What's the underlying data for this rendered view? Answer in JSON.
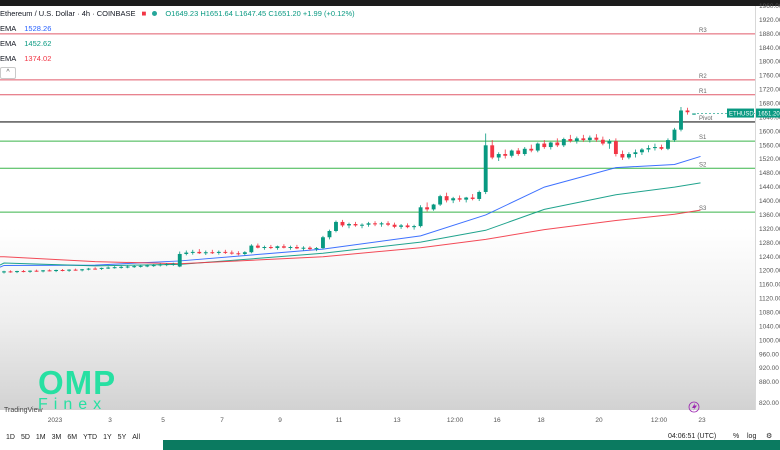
{
  "header": {
    "symbol": "Ethereum / U.S. Dollar · 4h · COINBASE",
    "ohlc": "O1649.23  H1651.64  L1647.45  C1651.20  +1.99 (+0.12%)",
    "close_icon": "close-icon",
    "status_icon": "dot-icon"
  },
  "indicators": [
    {
      "name": "EMA",
      "value": "1528.26",
      "color": "#2962ff"
    },
    {
      "name": "EMA",
      "value": "1452.62",
      "color": "#089981"
    },
    {
      "name": "EMA",
      "value": "1374.02",
      "color": "#f23645"
    }
  ],
  "toggle_label": "^",
  "tradingview_label": "TradingView",
  "price_tag": "1651.20",
  "ticker_tag": "ETHUSD",
  "time_ranges": [
    "1D",
    "5D",
    "1M",
    "3M",
    "6M",
    "YTD",
    "1Y",
    "5Y",
    "All"
  ],
  "clock": "04:06:51 (UTC)",
  "axis_controls": {
    "percent": "%",
    "log": "log",
    "settings_icon": "gear-icon"
  },
  "logo": {
    "line1": "OMP",
    "line2": "Finex"
  },
  "chart_data": {
    "type": "candlestick",
    "title": "Ethereum / U.S. Dollar · 4h · COINBASE",
    "ylim": [
      800,
      1960
    ],
    "yticks": [
      820,
      880,
      920,
      960,
      1000,
      1040,
      1080,
      1120,
      1160,
      1200,
      1240,
      1280,
      1320,
      1360,
      1400,
      1440,
      1480,
      1520,
      1560,
      1600,
      1640,
      1680,
      1720,
      1760,
      1800,
      1840,
      1880,
      1920,
      1960
    ],
    "xticks": [
      "2023",
      "3",
      "5",
      "7",
      "9",
      "11",
      "13",
      "12:00",
      "16",
      "18",
      "20",
      "12:00",
      "23"
    ],
    "levels": [
      {
        "name": "R3",
        "value": 1880,
        "color": "#e05a6a"
      },
      {
        "name": "R2",
        "value": 1748,
        "color": "#e05a6a"
      },
      {
        "name": "R1",
        "value": 1705,
        "color": "#e05a6a"
      },
      {
        "name": "Pivot",
        "value": 1627,
        "color": "#222222"
      },
      {
        "name": "S1",
        "value": 1572,
        "color": "#3ab54a"
      },
      {
        "name": "S2",
        "value": 1494,
        "color": "#3ab54a"
      },
      {
        "name": "S3",
        "value": 1368,
        "color": "#3ab54a"
      }
    ],
    "candles": [
      [
        1195,
        1200,
        1192,
        1198
      ],
      [
        1198,
        1201,
        1194,
        1196
      ],
      [
        1196,
        1200,
        1193,
        1199
      ],
      [
        1199,
        1202,
        1195,
        1197
      ],
      [
        1197,
        1201,
        1194,
        1200
      ],
      [
        1200,
        1203,
        1197,
        1198
      ],
      [
        1198,
        1202,
        1195,
        1201
      ],
      [
        1201,
        1204,
        1198,
        1199
      ],
      [
        1199,
        1203,
        1196,
        1202
      ],
      [
        1202,
        1205,
        1198,
        1200
      ],
      [
        1200,
        1204,
        1197,
        1203
      ],
      [
        1203,
        1206,
        1200,
        1201
      ],
      [
        1201,
        1205,
        1198,
        1204
      ],
      [
        1204,
        1208,
        1201,
        1206
      ],
      [
        1206,
        1210,
        1203,
        1205
      ],
      [
        1205,
        1209,
        1202,
        1208
      ],
      [
        1208,
        1212,
        1205,
        1209
      ],
      [
        1209,
        1213,
        1206,
        1210
      ],
      [
        1210,
        1214,
        1206,
        1211
      ],
      [
        1211,
        1215,
        1207,
        1212
      ],
      [
        1212,
        1216,
        1208,
        1213
      ],
      [
        1213,
        1217,
        1209,
        1214
      ],
      [
        1214,
        1218,
        1210,
        1215
      ],
      [
        1215,
        1219,
        1211,
        1216
      ],
      [
        1216,
        1221,
        1212,
        1218
      ],
      [
        1218,
        1222,
        1213,
        1219
      ],
      [
        1219,
        1223,
        1214,
        1220
      ],
      [
        1212,
        1255,
        1210,
        1248
      ],
      [
        1248,
        1258,
        1244,
        1252
      ],
      [
        1252,
        1260,
        1246,
        1254
      ],
      [
        1254,
        1262,
        1248,
        1250
      ],
      [
        1250,
        1258,
        1245,
        1253
      ],
      [
        1253,
        1260,
        1248,
        1251
      ],
      [
        1251,
        1258,
        1246,
        1254
      ],
      [
        1254,
        1260,
        1248,
        1252
      ],
      [
        1252,
        1258,
        1246,
        1250
      ],
      [
        1250,
        1256,
        1244,
        1248
      ],
      [
        1248,
        1256,
        1244,
        1253
      ],
      [
        1253,
        1276,
        1250,
        1272
      ],
      [
        1272,
        1278,
        1264,
        1266
      ],
      [
        1266,
        1272,
        1260,
        1268
      ],
      [
        1268,
        1274,
        1262,
        1265
      ],
      [
        1265,
        1272,
        1260,
        1270
      ],
      [
        1270,
        1276,
        1264,
        1266
      ],
      [
        1266,
        1272,
        1260,
        1268
      ],
      [
        1268,
        1274,
        1262,
        1264
      ],
      [
        1264,
        1270,
        1258,
        1266
      ],
      [
        1266,
        1270,
        1258,
        1262
      ],
      [
        1262,
        1268,
        1256,
        1265
      ],
      [
        1265,
        1300,
        1262,
        1296
      ],
      [
        1296,
        1318,
        1290,
        1314
      ],
      [
        1314,
        1344,
        1310,
        1340
      ],
      [
        1340,
        1346,
        1325,
        1330
      ],
      [
        1330,
        1338,
        1322,
        1334
      ],
      [
        1334,
        1340,
        1326,
        1330
      ],
      [
        1330,
        1336,
        1322,
        1332
      ],
      [
        1332,
        1340,
        1326,
        1336
      ],
      [
        1336,
        1342,
        1328,
        1333
      ],
      [
        1333,
        1340,
        1326,
        1336
      ],
      [
        1336,
        1342,
        1328,
        1332
      ],
      [
        1332,
        1338,
        1322,
        1326
      ],
      [
        1326,
        1334,
        1320,
        1330
      ],
      [
        1330,
        1336,
        1322,
        1325
      ],
      [
        1325,
        1332,
        1318,
        1328
      ],
      [
        1328,
        1388,
        1324,
        1382
      ],
      [
        1382,
        1396,
        1370,
        1376
      ],
      [
        1376,
        1392,
        1372,
        1390
      ],
      [
        1390,
        1418,
        1386,
        1414
      ],
      [
        1414,
        1424,
        1396,
        1402
      ],
      [
        1402,
        1412,
        1394,
        1408
      ],
      [
        1408,
        1416,
        1398,
        1404
      ],
      [
        1404,
        1412,
        1396,
        1410
      ],
      [
        1410,
        1420,
        1402,
        1406
      ],
      [
        1406,
        1430,
        1400,
        1426
      ],
      [
        1426,
        1594,
        1420,
        1560
      ],
      [
        1560,
        1575,
        1520,
        1525
      ],
      [
        1525,
        1540,
        1515,
        1535
      ],
      [
        1535,
        1548,
        1522,
        1530
      ],
      [
        1530,
        1548,
        1525,
        1545
      ],
      [
        1545,
        1552,
        1530,
        1535
      ],
      [
        1535,
        1555,
        1530,
        1550
      ],
      [
        1550,
        1562,
        1540,
        1545
      ],
      [
        1545,
        1568,
        1540,
        1565
      ],
      [
        1565,
        1575,
        1550,
        1555
      ],
      [
        1555,
        1570,
        1548,
        1568
      ],
      [
        1568,
        1580,
        1555,
        1560
      ],
      [
        1560,
        1582,
        1555,
        1578
      ],
      [
        1578,
        1590,
        1568,
        1572
      ],
      [
        1572,
        1585,
        1565,
        1580
      ],
      [
        1580,
        1590,
        1570,
        1575
      ],
      [
        1575,
        1588,
        1568,
        1582
      ],
      [
        1582,
        1592,
        1570,
        1576
      ],
      [
        1576,
        1585,
        1560,
        1565
      ],
      [
        1565,
        1578,
        1550,
        1572
      ],
      [
        1572,
        1580,
        1528,
        1535
      ],
      [
        1535,
        1545,
        1518,
        1525
      ],
      [
        1525,
        1540,
        1520,
        1535
      ],
      [
        1535,
        1548,
        1525,
        1540
      ],
      [
        1540,
        1552,
        1532,
        1548
      ],
      [
        1548,
        1560,
        1540,
        1552
      ],
      [
        1552,
        1565,
        1545,
        1555
      ],
      [
        1555,
        1562,
        1546,
        1550
      ],
      [
        1550,
        1580,
        1546,
        1575
      ],
      [
        1575,
        1610,
        1570,
        1605
      ],
      [
        1605,
        1670,
        1600,
        1660
      ],
      [
        1660,
        1668,
        1648,
        1655
      ],
      [
        1649.23,
        1651.64,
        1647.45,
        1651.2
      ]
    ],
    "series": [
      {
        "name": "EMA",
        "x": [
          0,
          14,
          27,
          49,
          64,
          74,
          83,
          94,
          103,
          107
        ],
        "values": [
          1215,
          1216,
          1228,
          1262,
          1300,
          1360,
          1440,
          1496,
          1505,
          1528
        ]
      },
      {
        "name": "EMA",
        "x": [
          0,
          14,
          27,
          49,
          64,
          74,
          83,
          94,
          103,
          107
        ],
        "values": [
          1222,
          1214,
          1218,
          1250,
          1282,
          1316,
          1376,
          1418,
          1440,
          1452
        ]
      },
      {
        "name": "EMA",
        "x": [
          0,
          14,
          27,
          49,
          64,
          74,
          83,
          94,
          103,
          107
        ],
        "values": [
          1240,
          1226,
          1220,
          1240,
          1266,
          1290,
          1318,
          1344,
          1362,
          1374
        ]
      }
    ]
  }
}
